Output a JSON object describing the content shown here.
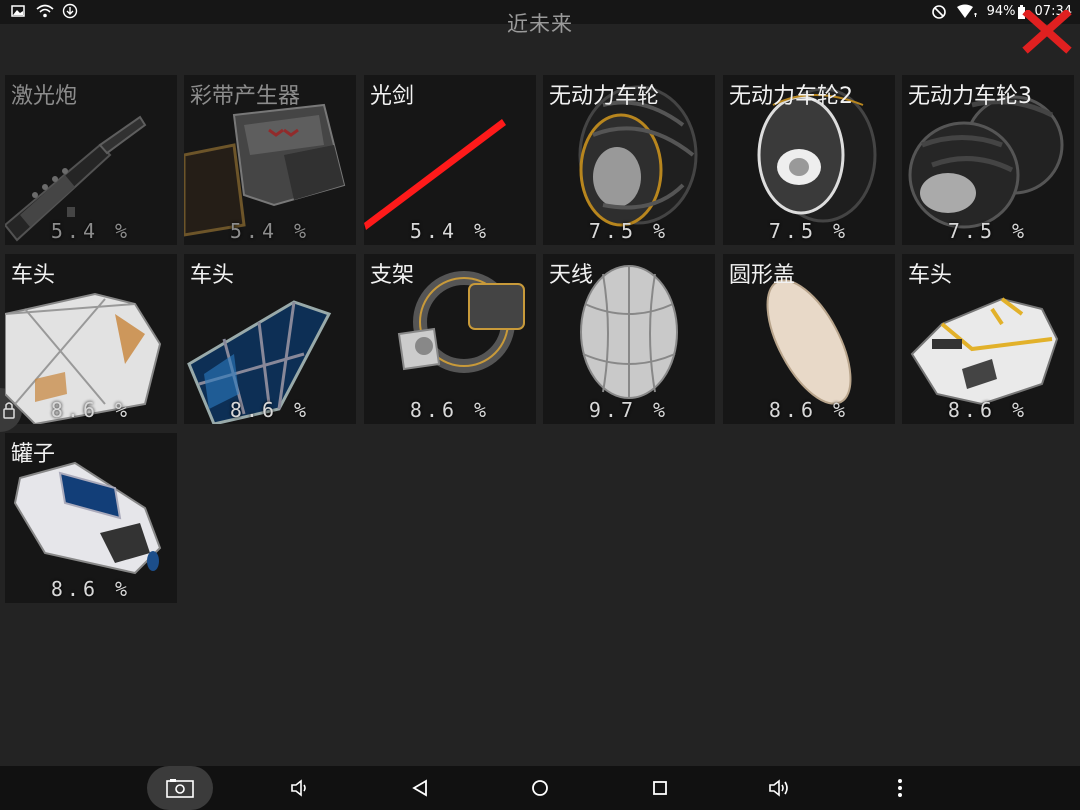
{
  "status_bar": {
    "battery_percent": "94%",
    "time": "07:34",
    "icons": [
      "gallery-icon",
      "wifi-icon",
      "download-icon",
      "do-not-disturb-icon",
      "wifi-signal-icon",
      "battery-icon"
    ]
  },
  "header": {
    "title": "近未来",
    "close_icon": "close-x-icon",
    "close_color": "#e02020"
  },
  "items": [
    {
      "name": "激光炮",
      "percent": "5.4 %",
      "dim": true,
      "icon": "laser-cannon-icon"
    },
    {
      "name": "彩带产生器",
      "percent": "5.4 %",
      "dim": true,
      "icon": "ribbon-generator-icon"
    },
    {
      "name": "光剑",
      "percent": "5.4 %",
      "dim": false,
      "icon": "lightsaber-icon"
    },
    {
      "name": "无动力车轮",
      "percent": "7.5 %",
      "dim": false,
      "icon": "wheel-icon"
    },
    {
      "name": "无动力车轮2",
      "percent": "7.5 %",
      "dim": false,
      "icon": "wheel-icon"
    },
    {
      "name": "无动力车轮3",
      "percent": "7.5 %",
      "dim": false,
      "icon": "double-wheel-icon"
    },
    {
      "name": "车头",
      "percent": "8.6 %",
      "dim": false,
      "icon": "cabin-icon"
    },
    {
      "name": "车头",
      "percent": "8.6 %",
      "dim": false,
      "icon": "glass-cockpit-icon"
    },
    {
      "name": "支架",
      "percent": "8.6 %",
      "dim": false,
      "icon": "bracket-icon"
    },
    {
      "name": "天线",
      "percent": "9.7 %",
      "dim": false,
      "icon": "antenna-dish-icon"
    },
    {
      "name": "圆形盖",
      "percent": "8.6 %",
      "dim": false,
      "icon": "round-cover-icon"
    },
    {
      "name": "车头",
      "percent": "8.6 %",
      "dim": false,
      "icon": "spaceship-nose-icon"
    },
    {
      "name": "罐子",
      "percent": "8.6 %",
      "dim": false,
      "icon": "tank-icon"
    }
  ],
  "navbar": {
    "buttons": [
      "screenshot-icon",
      "volume-down-icon",
      "back-icon",
      "home-icon",
      "recents-icon",
      "volume-up-icon",
      "more-icon"
    ]
  }
}
